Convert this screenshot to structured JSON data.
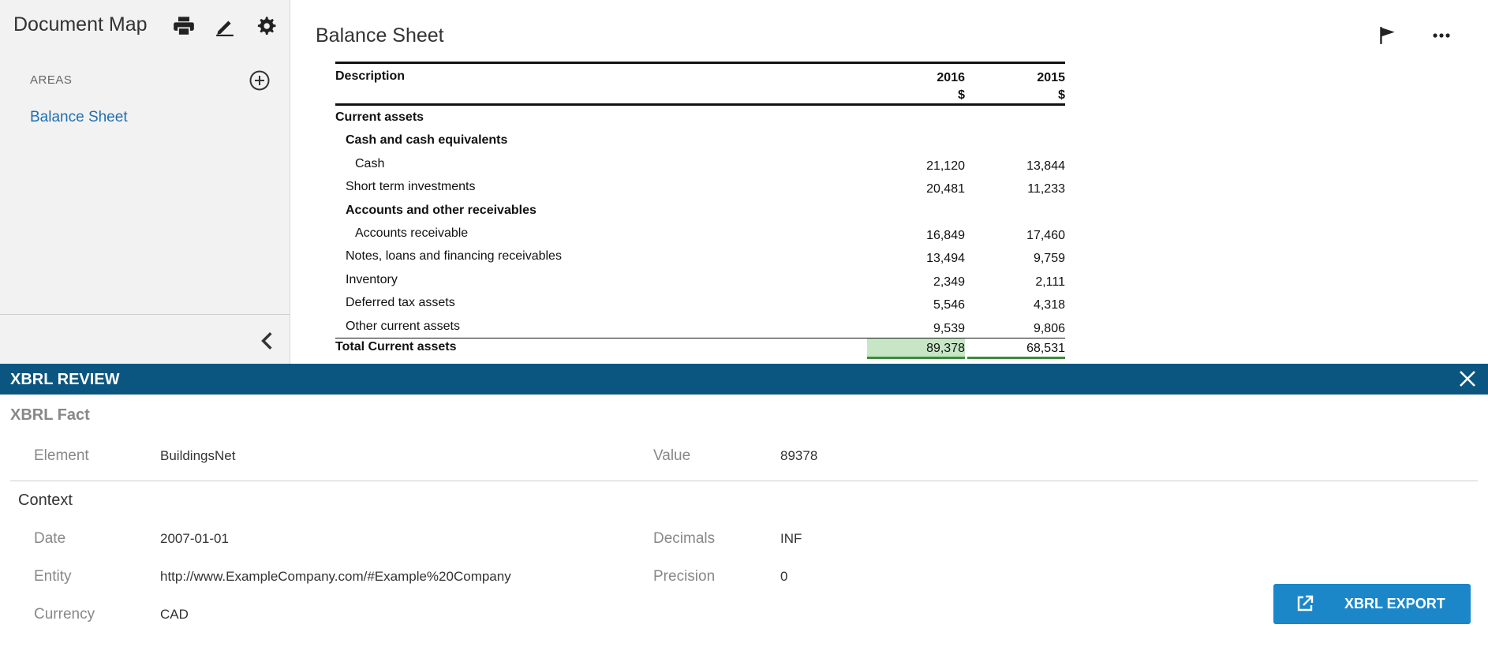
{
  "sidebar": {
    "title": "Document Map",
    "areas_label": "AREAS",
    "items": [
      {
        "label": "Balance Sheet"
      }
    ]
  },
  "main": {
    "title": "Balance Sheet"
  },
  "table": {
    "header": {
      "description": "Description",
      "col1": "2016",
      "col2": "2015",
      "unit1": "$",
      "unit2": "$"
    },
    "rows": [
      {
        "label": "Current assets",
        "v1": "",
        "v2": ""
      },
      {
        "label": "Cash and cash equivalents",
        "v1": "",
        "v2": ""
      },
      {
        "label": "Cash",
        "v1": "21,120",
        "v2": "13,844"
      },
      {
        "label": "Short term investments",
        "v1": "20,481",
        "v2": "11,233"
      },
      {
        "label": "Accounts and other receivables",
        "v1": "",
        "v2": ""
      },
      {
        "label": "Accounts receivable",
        "v1": "16,849",
        "v2": "17,460"
      },
      {
        "label": "Notes, loans and financing receivables",
        "v1": "13,494",
        "v2": "9,759"
      },
      {
        "label": "Inventory",
        "v1": "2,349",
        "v2": "2,111"
      },
      {
        "label": "Deferred tax assets",
        "v1": "5,546",
        "v2": "4,318"
      },
      {
        "label": "Other current assets",
        "v1": "9,539",
        "v2": "9,806"
      },
      {
        "label": "Total Current assets",
        "v1": "89,378",
        "v2": "68,531"
      }
    ]
  },
  "review": {
    "title": "XBRL REVIEW",
    "fact_title": "XBRL Fact",
    "element_label": "Element",
    "element_value": "BuildingsNet",
    "value_label": "Value",
    "value_value": "89378",
    "context_title": "Context",
    "date_label": "Date",
    "date_value": "2007-01-01",
    "entity_label": "Entity",
    "entity_value": "http://www.ExampleCompany.com/#Example%20Company",
    "currency_label": "Currency",
    "currency_value": "CAD",
    "decimals_label": "Decimals",
    "decimals_value": "INF",
    "precision_label": "Precision",
    "precision_value": "0",
    "export_label": "XBRL EXPORT"
  },
  "colors": {
    "accent": "#0b5680",
    "button": "#1b87c9",
    "link": "#1f6fb0",
    "highlight": "#c6e6c6"
  }
}
